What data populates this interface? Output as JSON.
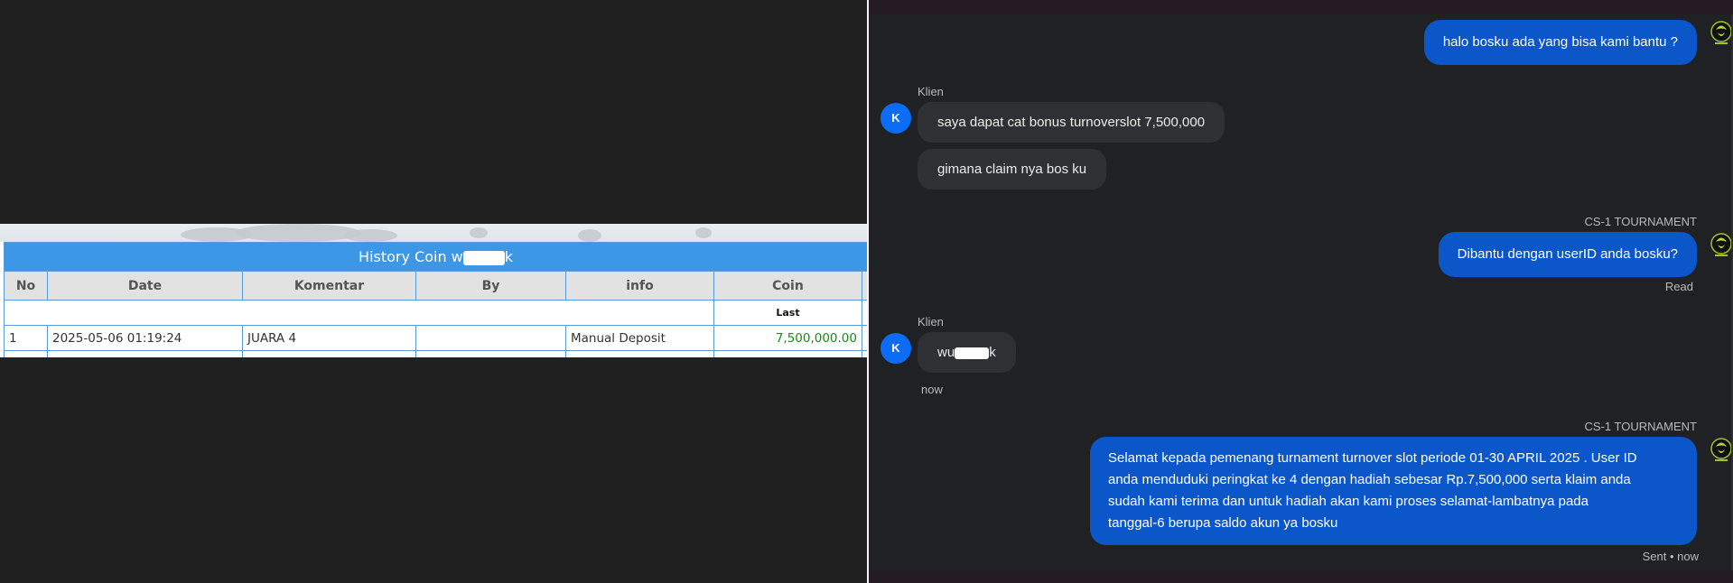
{
  "history": {
    "title_prefix": "History Coin w",
    "title_suffix": "k",
    "columns": [
      "No",
      "Date",
      "Komentar",
      "By",
      "info",
      "Coin"
    ],
    "last_label": "Last",
    "rows": [
      {
        "no": "1",
        "date": "2025-05-06 01:19:24",
        "komentar": "JUARA 4",
        "by": "",
        "info": "Manual Deposit",
        "coin": "7,500,000.00"
      }
    ]
  },
  "chat": {
    "messages": [
      {
        "type": "agent",
        "text": "halo bosku ada yang bisa kami bantu ?"
      },
      {
        "type": "client_label",
        "text": "Klien"
      },
      {
        "type": "client",
        "avatar": "K",
        "text": "saya dapat cat bonus turnoverslot 7,500,000"
      },
      {
        "type": "client",
        "text": "gimana claim nya bos ku"
      },
      {
        "type": "agent_label",
        "text": "CS-1 TOURNAMENT"
      },
      {
        "type": "agent",
        "text": "Dibantu dengan userID anda bosku?",
        "status": "Read"
      },
      {
        "type": "client_label",
        "text": "Klien"
      },
      {
        "type": "client",
        "avatar": "K",
        "text_prefix": "wu",
        "text_suffix": "k",
        "time": "now"
      },
      {
        "type": "agent_label",
        "text": "CS-1 TOURNAMENT"
      },
      {
        "type": "agent",
        "lines": [
          "Selamat kepada pemenang turnament turnover slot periode 01-30 APRIL 2025 . User ID",
          "anda menduduki peringkat ke 4 dengan hadiah sebesar Rp.7,500,000 serta klaim anda",
          "sudah kami terima dan untuk hadiah akan kami proses selamat-lambatnya pada",
          "tanggal-6 berupa saldo akun ya bosku"
        ],
        "status": "Sent • now"
      }
    ]
  },
  "colors": {
    "table_header": "#3c97e6",
    "coin_green": "#1a8a1a",
    "agent_bubble": "#0b57c9",
    "client_bubble": "#2f3033",
    "avatar_blue": "#0b6cf5"
  },
  "icons": [
    "agent-logo-icon",
    "client-avatar"
  ]
}
